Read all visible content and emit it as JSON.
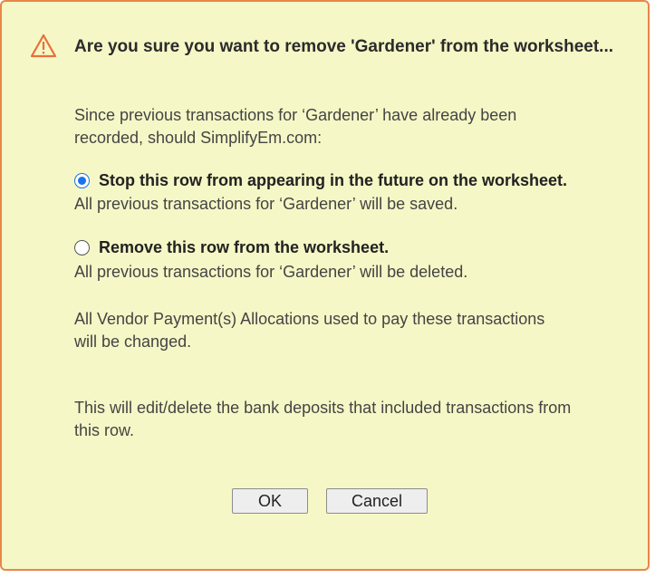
{
  "dialog": {
    "title": "Are you sure you want to remove 'Gardener' from the worksheet...",
    "intro_line1": "Since previous transactions for ‘Gardener’ have already been",
    "intro_line2": "recorded, should SimplifyEm.com:",
    "options": [
      {
        "label": "Stop this row from appearing in the future on the worksheet.",
        "description": "All previous transactions for ‘Gardener’ will be saved.",
        "selected": true
      },
      {
        "label": "Remove this row from the worksheet.",
        "description": "All previous transactions for ‘Gardener’ will be deleted.",
        "selected": false
      }
    ],
    "allocations_line1": "All Vendor Payment(s) Allocations used to pay these transactions",
    "allocations_line2": "will be changed.",
    "deposits_line1": "This will edit/delete the bank deposits that included transactions from",
    "deposits_line2": "this row.",
    "ok_label": "OK",
    "cancel_label": "Cancel"
  },
  "colors": {
    "background": "#f6f7c6",
    "border": "#e8864a",
    "radio_accent": "#1a73e8"
  },
  "icons": {
    "title": "warning-icon"
  }
}
